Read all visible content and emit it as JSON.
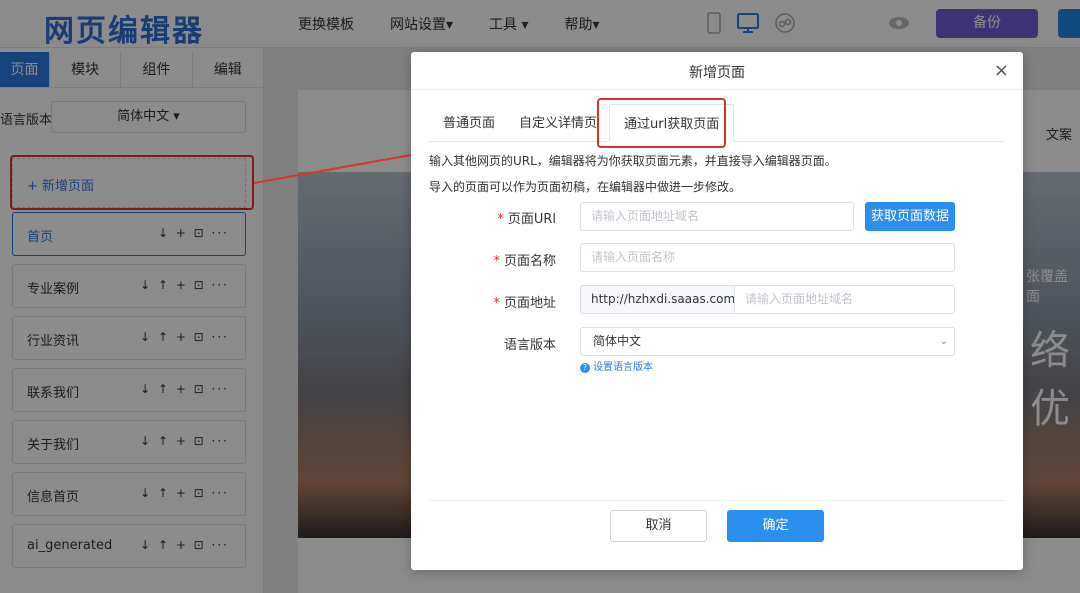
{
  "app": {
    "logo": "网页编辑器"
  },
  "topnav": {
    "items": [
      "更换模板",
      "网站设置▾",
      "工具 ▾",
      "帮助▾"
    ],
    "backup_label": "备份"
  },
  "sidebar": {
    "tabs": [
      "页面",
      "模块",
      "组件",
      "编辑"
    ],
    "lang_label": "语言版本",
    "lang_value": "简体中文 ▾",
    "add_page": "+ 新增页面",
    "pages": [
      {
        "name": "首页",
        "actions": "↓ + ⊡ ···"
      },
      {
        "name": "专业案例",
        "actions": "↓ ↑ + ⊡ ···"
      },
      {
        "name": "行业资讯",
        "actions": "↓ ↑ + ⊡ ···"
      },
      {
        "name": "联系我们",
        "actions": "↓ ↑ + ⊡ ···"
      },
      {
        "name": "关于我们",
        "actions": "↓ ↑ + ⊡ ···"
      },
      {
        "name": "信息首页",
        "actions": "↓ ↑ + ⊡ ···"
      },
      {
        "name": "ai_generated",
        "actions": "↓ ↑ + ⊡ ···"
      }
    ]
  },
  "canvas": {
    "right_label": "文案",
    "right_caption": "张覆盖面",
    "right_big": "络优"
  },
  "modal": {
    "title": "新增页面",
    "close": "×",
    "tabs": [
      "普通页面",
      "自定义详情页",
      "通过url获取页面"
    ],
    "hint1": "输入其他网页的URL，编辑器将为你获取页面元素，并直接导入编辑器页面。",
    "hint2": "导入的页面可以作为页面初稿，在编辑器中做进一步修改。",
    "fields": {
      "url_label": "页面URl",
      "url_placeholder": "请输入页面地址域名",
      "fetch_button": "获取页面数据",
      "name_label": "页面名称",
      "name_placeholder": "请输入页面名称",
      "addr_label": "页面地址",
      "addr_prefix": "http://hzhxdi.saaas.com/",
      "addr_placeholder": "请输入页面地址域名",
      "lang_label": "语言版本",
      "lang_value": "简体中文",
      "set_lang": "设置语言版本"
    },
    "cancel": "取消",
    "ok": "确定"
  }
}
